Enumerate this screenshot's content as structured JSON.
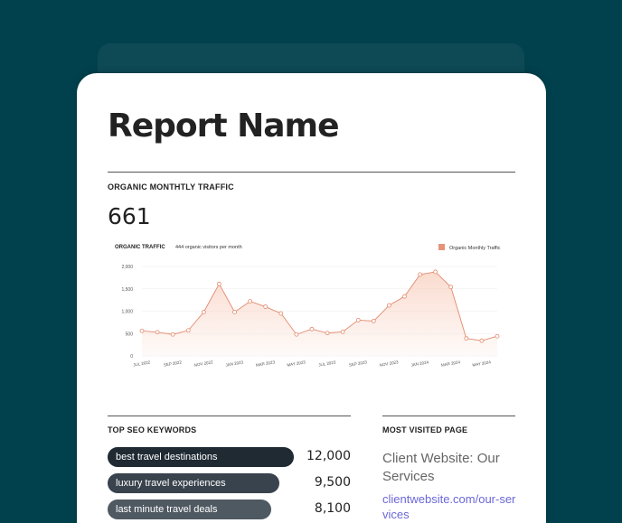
{
  "report": {
    "title": "Report Name"
  },
  "traffic": {
    "label": "ORGANIC MONTHTLY TRAFFIC",
    "value": "661"
  },
  "chart_data": {
    "type": "area",
    "title": "ORGANIC TRAFFIC",
    "subtitle": "444 organic visitors per month",
    "legend": "top-right",
    "series": [
      {
        "name": "Organic Monthly Traffic",
        "values": [
          560,
          530,
          480,
          570,
          980,
          1610,
          980,
          1220,
          1100,
          950,
          480,
          600,
          510,
          540,
          800,
          780,
          1130,
          1330,
          1820,
          1880,
          1540,
          390,
          340,
          440
        ]
      }
    ],
    "x": [
      "JUL 2022",
      "AUG 2022",
      "SEP 2022",
      "OCT 2022",
      "NOV 2022",
      "DEC 2022",
      "JAN 2023",
      "FEB 2023",
      "MAR 2023",
      "APR 2023",
      "MAY 2023",
      "JUN 2023",
      "JUL 2023",
      "AUG 2023",
      "SEP 2023",
      "OCT 2023",
      "NOV 2023",
      "DEC 2023",
      "JAN 2024",
      "FEB 2024",
      "MAR 2024",
      "APR 2024",
      "MAY 2024",
      "JUN 2024"
    ],
    "x_tick_labels": [
      "JUL 2022",
      "SEP 2022",
      "NOV 2022",
      "JAN 2023",
      "MAR 2023",
      "MAY 2023",
      "JUL 2023",
      "SEP 2023",
      "NOV 2023",
      "JAN 2024",
      "MAR 2024",
      "MAY 2024"
    ],
    "y_ticks": [
      "2,000",
      "1,500",
      "1,000",
      "500",
      "0"
    ],
    "ylim": [
      0,
      2000
    ],
    "grid": true,
    "colors": {
      "line": "#e2896c",
      "fill": "#f9d5c6",
      "legend_swatch": "#e59477"
    }
  },
  "keywords": {
    "label": "TOP SEO KEYWORDS",
    "items": [
      {
        "keyword": "best travel destinations",
        "volume": "12,000",
        "color": "#1f2a33"
      },
      {
        "keyword": "luxury travel experiences",
        "volume": "9,500",
        "color": "#39434d"
      },
      {
        "keyword": "last minute travel deals",
        "volume": "8,100",
        "color": "#4f5962"
      }
    ]
  },
  "most_visited": {
    "label": "MOST VISITED PAGE",
    "page_title": "Client Website: Our Services",
    "url": "clientwebsite.com/our-services"
  }
}
